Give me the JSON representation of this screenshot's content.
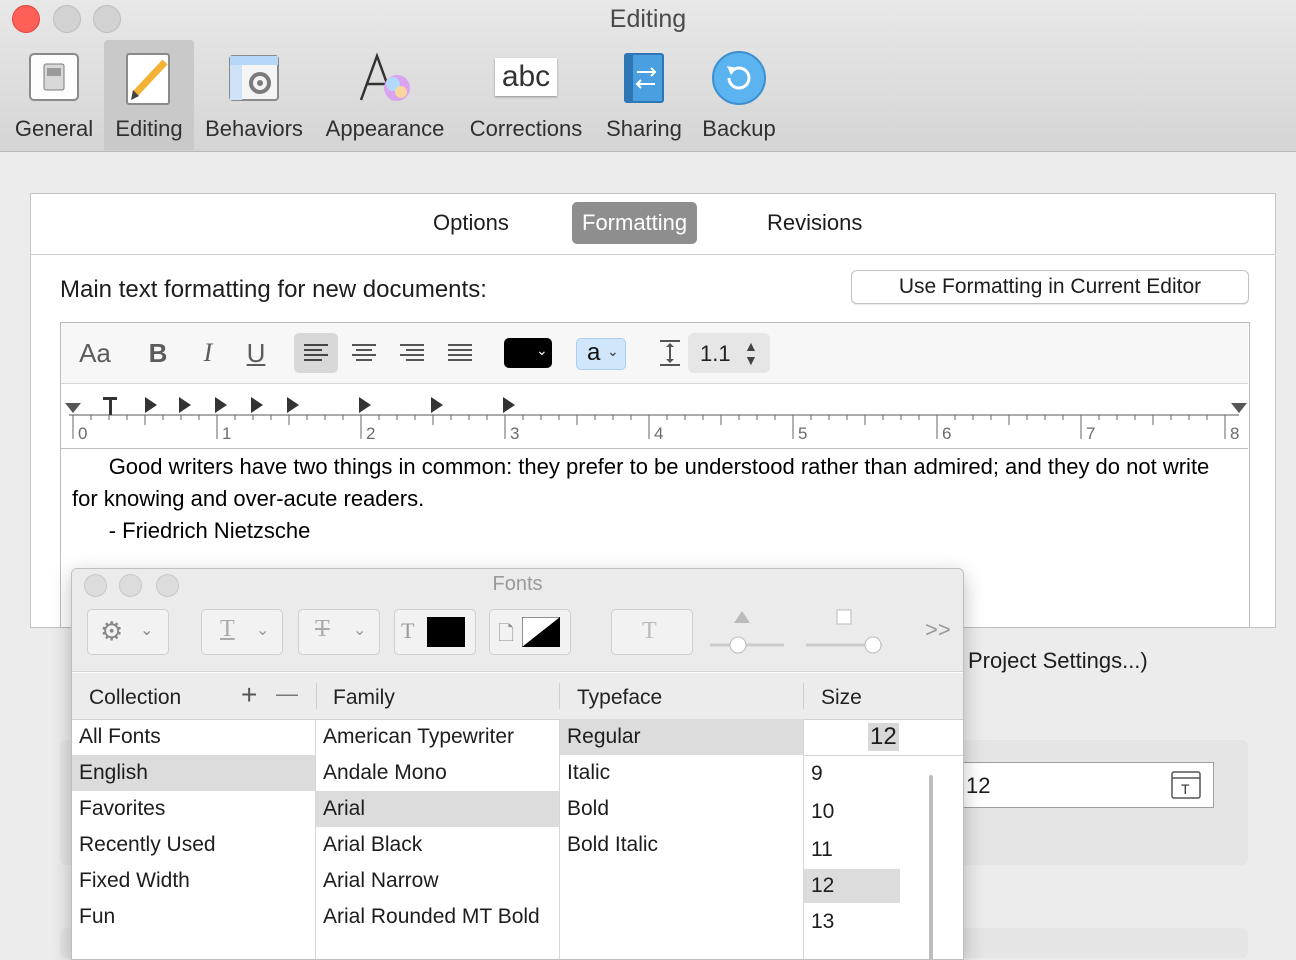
{
  "window": {
    "title": "Editing"
  },
  "toolbar": {
    "items": [
      {
        "label": "General",
        "icon": "general-icon"
      },
      {
        "label": "Editing",
        "icon": "editing-icon",
        "active": true
      },
      {
        "label": "Behaviors",
        "icon": "behaviors-icon"
      },
      {
        "label": "Appearance",
        "icon": "appearance-icon"
      },
      {
        "label": "Corrections",
        "icon": "corrections-icon",
        "icon_text": "abc"
      },
      {
        "label": "Sharing",
        "icon": "sharing-icon"
      },
      {
        "label": "Backup",
        "icon": "backup-icon"
      }
    ]
  },
  "tabs": [
    {
      "label": "Options"
    },
    {
      "label": "Formatting",
      "active": true
    },
    {
      "label": "Revisions"
    }
  ],
  "main": {
    "label": "Main text formatting for new documents:",
    "use_formatting_button": "Use Formatting in Current Editor"
  },
  "format_bar": {
    "fonts_label": "Aa",
    "bold": "B",
    "italic": "I",
    "underline": "U",
    "highlight_letter": "a",
    "line_spacing": "1.1",
    "text_color": "#000000",
    "highlight_color": "#cfe6fb"
  },
  "ruler": {
    "numbers": [
      "0",
      "1",
      "2",
      "3",
      "4",
      "5",
      "6",
      "7",
      "8"
    ]
  },
  "editor_text": {
    "line1": "      Good writers have two things in common: they prefer to be understood rather than admired; and they do not write for knowing and over-acute readers.",
    "line2": "      - Friedrich Nietzsche"
  },
  "behind": {
    "project_settings_text": "Project Settings...)",
    "size_value": "12"
  },
  "fonts_panel": {
    "title": "Fonts",
    "columns": {
      "collection": "Collection",
      "family": "Family",
      "typeface": "Typeface",
      "size": "Size"
    },
    "collection_items": [
      "All Fonts",
      "English",
      "Favorites",
      "Recently Used",
      "Fixed Width",
      "Fun"
    ],
    "collection_selected": "English",
    "family_items": [
      "American Typewriter",
      "Andale Mono",
      "Arial",
      "Arial Black",
      "Arial Narrow",
      "Arial Rounded MT Bold"
    ],
    "family_selected": "Arial",
    "typeface_items": [
      "Regular",
      "Italic",
      "Bold",
      "Bold Italic"
    ],
    "typeface_selected": "Regular",
    "size_field": "12",
    "size_items": [
      "9",
      "10",
      "11",
      "12",
      "13"
    ],
    "size_selected": "12",
    "more_label": ">>",
    "add_label": "+",
    "remove_label": "—"
  }
}
